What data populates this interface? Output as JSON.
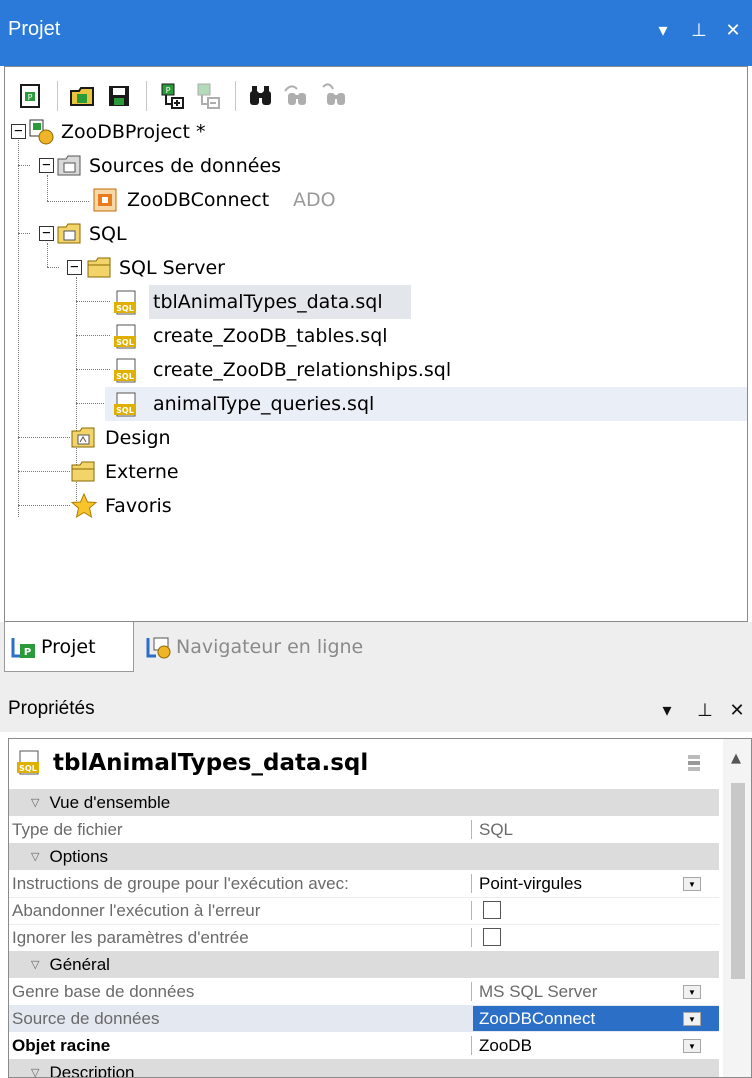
{
  "project_panel": {
    "title": "Projet",
    "controls": {
      "dropdown": "▾",
      "pin": "⊥",
      "close": "✕"
    }
  },
  "toolbar": {
    "buttons": [
      "new-project-icon",
      "open-project-icon",
      "save-project-icon",
      "add-to-project-icon",
      "remove-from-project-icon",
      "find-icon",
      "find-next-icon",
      "find-in-files-icon"
    ]
  },
  "tree": {
    "root": "ZooDBProject *",
    "data_sources": "Sources de données",
    "connection_name": "ZooDBConnect",
    "connection_type": "ADO",
    "sql": "SQL",
    "sql_server": "SQL Server",
    "files": [
      "tblAnimalTypes_data.sql",
      "create_ZooDB_tables.sql",
      "create_ZooDB_relationships.sql",
      "animalType_queries.sql"
    ],
    "design": "Design",
    "external": "Externe",
    "favorites": "Favoris",
    "expanders": {
      "minus": "−"
    }
  },
  "tabs": {
    "project": "Projet",
    "online_browser": "Navigateur en ligne"
  },
  "properties": {
    "title": "Propriétés",
    "object_name": "tblAnimalTypes_data.sql",
    "categories": {
      "overview": "Vue d'ensemble",
      "options": "Options",
      "general": "Général",
      "description": "Description"
    },
    "rows": {
      "file_type_label": "Type de fichier",
      "file_type_value": "SQL",
      "group_label": "Instructions de groupe pour l'exécution avec:",
      "group_value": "Point-virgules",
      "abort_label": "Abandonner l'exécution à l'erreur",
      "ignore_label": "Ignorer les paramètres d'entrée",
      "db_kind_label": "Genre base de données",
      "db_kind_value": "MS SQL Server",
      "datasource_label": "Source de données",
      "datasource_value": "ZooDBConnect",
      "root_label": "Objet racine",
      "root_value": "ZooDB"
    },
    "accent_color": "#2c6fc6",
    "title_bar_color": "#2b79d9"
  }
}
